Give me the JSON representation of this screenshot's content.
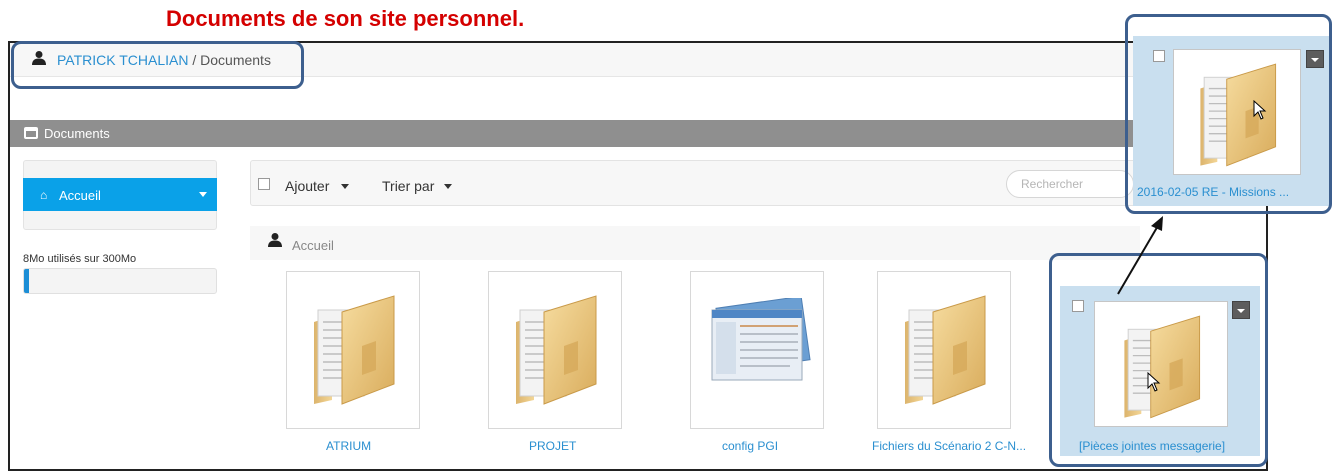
{
  "heading": {
    "title": "Documents de son site personnel",
    "punct": "."
  },
  "breadcrumb": {
    "user": "PATRICK TCHALIAN",
    "separator": " / ",
    "current": "Documents"
  },
  "section": {
    "title": "Documents"
  },
  "sidebar": {
    "home_label": "Accueil",
    "quota_text": "8Mo utilisés sur 300Mo",
    "quota_used_fraction": 0.027
  },
  "toolbar": {
    "add_label": "Ajouter",
    "sort_label": "Trier par",
    "search_placeholder": "Rechercher"
  },
  "folder_crumb": {
    "label": "Accueil"
  },
  "tiles": [
    {
      "label": "ATRIUM",
      "icon": "folder-icon"
    },
    {
      "label": "PROJET",
      "icon": "folder-icon"
    },
    {
      "label": "config PGI",
      "icon": "document-icon"
    },
    {
      "label": "Fichiers du Scénario 2 C-N...",
      "icon": "folder-icon"
    },
    {
      "label": "[Pièces jointes messagerie]",
      "icon": "folder-icon",
      "selected": true
    }
  ],
  "zoom_tile": {
    "label": "2016-02-05 RE - Missions ...",
    "icon": "folder-icon"
  },
  "colors": {
    "accent": "#0aa1e8",
    "link": "#2a8fd0",
    "highlight_border": "#3d5f8e",
    "heading": "#d40000",
    "selection": "#c9dfef"
  }
}
